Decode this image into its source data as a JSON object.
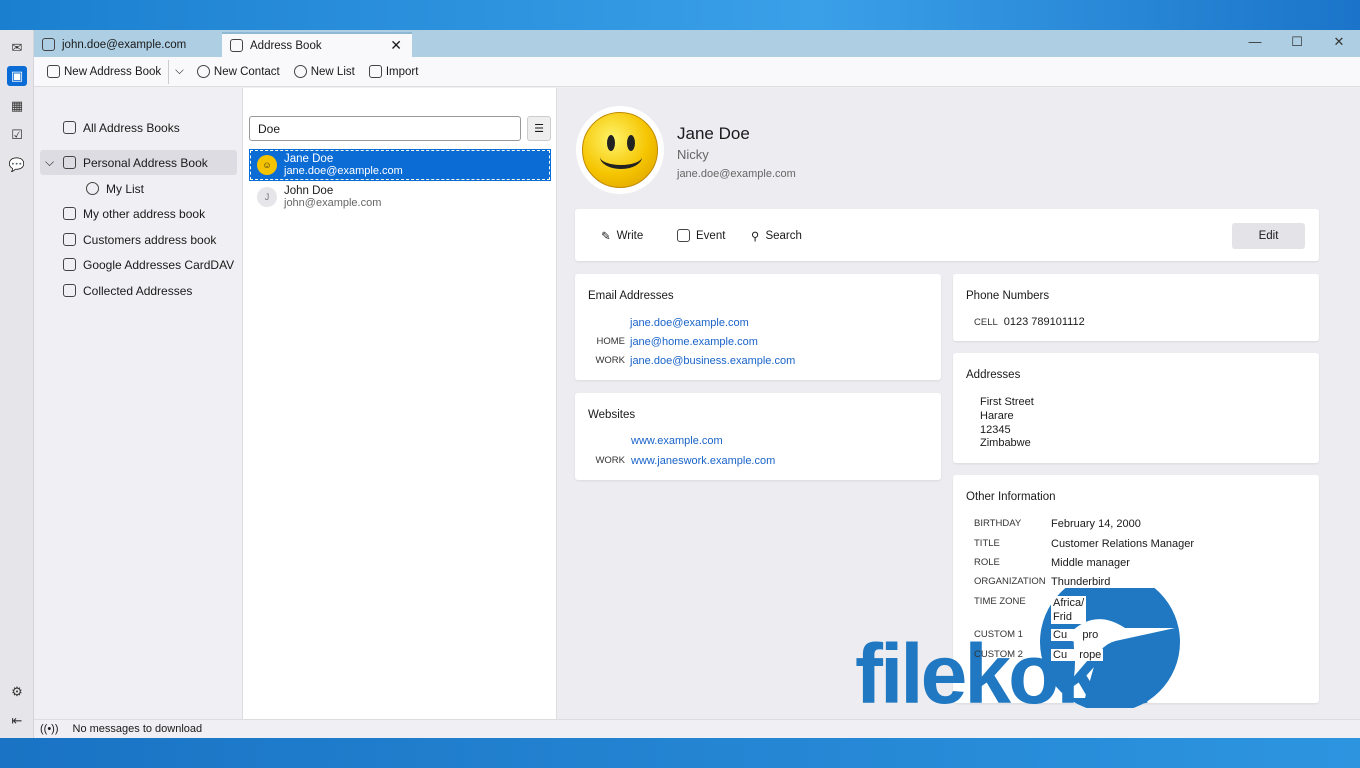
{
  "tabs": [
    {
      "label": "john.doe@example.com",
      "icon": "mail-contacts-icon"
    },
    {
      "label": "Address Book",
      "icon": "address-book-icon"
    }
  ],
  "toolbar": {
    "new_address_book": "New Address Book",
    "new_contact": "New Contact",
    "new_list": "New List",
    "import": "Import"
  },
  "sidebar": {
    "items": [
      {
        "label": "All Address Books"
      },
      {
        "label": "Personal Address Book",
        "selected": true
      },
      {
        "label": "My List",
        "is_list": true
      },
      {
        "label": "My other address book"
      },
      {
        "label": "Customers address book"
      },
      {
        "label": "Google Addresses CardDAV"
      },
      {
        "label": "Collected Addresses"
      }
    ]
  },
  "search": {
    "value": "Doe"
  },
  "contacts": [
    {
      "name": "Jane Doe",
      "email": "jane.doe@example.com",
      "selected": true
    },
    {
      "name": "John Doe",
      "email": "john@example.com",
      "initial": "J"
    }
  ],
  "detail": {
    "name": "Jane Doe",
    "nickname": "Nicky",
    "email": "jane.doe@example.com",
    "actions": {
      "write": "Write",
      "event": "Event",
      "search": "Search",
      "edit": "Edit"
    },
    "emails": {
      "title": "Email Addresses",
      "items": [
        {
          "label": "",
          "value": "jane.doe@example.com"
        },
        {
          "label": "HOME",
          "value": "jane@home.example.com"
        },
        {
          "label": "WORK",
          "value": "jane.doe@business.example.com"
        }
      ]
    },
    "websites": {
      "title": "Websites",
      "items": [
        {
          "label": "",
          "value": "www.example.com"
        },
        {
          "label": "WORK",
          "value": "www.janeswork.example.com"
        }
      ]
    },
    "phones": {
      "title": "Phone Numbers",
      "items": [
        {
          "label": "CELL",
          "value": "0123 789101112"
        }
      ]
    },
    "addresses": {
      "title": "Addresses",
      "lines": [
        "First Street",
        "Harare",
        "12345",
        "Zimbabwe"
      ]
    },
    "other": {
      "title": "Other Information",
      "items": [
        {
          "label": "BIRTHDAY",
          "value": "February 14, 2000"
        },
        {
          "label": "TITLE",
          "value": "Customer Relations Manager"
        },
        {
          "label": "ROLE",
          "value": "Middle manager"
        },
        {
          "label": "ORGANIZATION",
          "value": "Thunderbird"
        },
        {
          "label": "TIME ZONE",
          "value": "Africa/",
          "value2": "Frid"
        },
        {
          "label": "CUSTOM 1",
          "value": "Cu     pro"
        },
        {
          "label": "CUSTOM 2",
          "value": "Cu    rope"
        }
      ]
    }
  },
  "status": {
    "text": "No messages to download"
  },
  "watermark": "filekoka",
  "colors": {
    "accent": "#0b6cd6",
    "link": "#1863c9",
    "watermark": "#1f78c1"
  }
}
